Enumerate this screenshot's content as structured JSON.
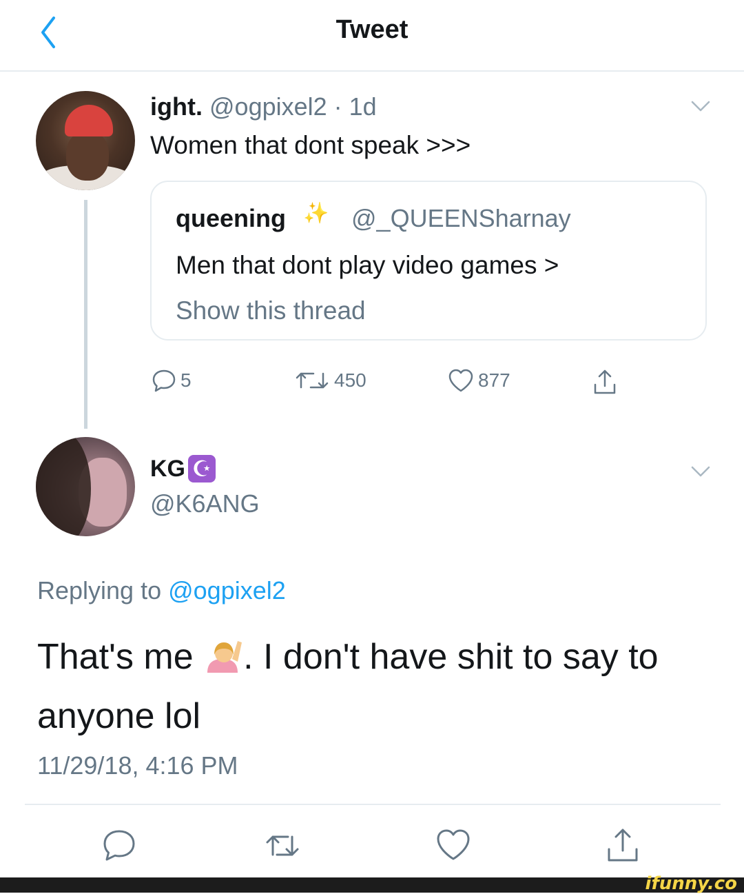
{
  "header": {
    "title": "Tweet",
    "back_icon": "chevron-left-icon"
  },
  "tweet1": {
    "name": "ight.",
    "handle": "@ogpixel2",
    "separator": " · ",
    "age": "1d",
    "text": "Women that dont speak >>>",
    "quote": {
      "name": "queening",
      "sparkle": "✨",
      "handle": "@_QUEENSharnay",
      "text": "Men that dont play video games >",
      "show_thread": "Show this thread"
    },
    "actions": {
      "replies": "5",
      "retweets": "450",
      "likes": "877"
    }
  },
  "tweet2": {
    "name": "KG",
    "badge": "☪",
    "handle": "@K6ANG",
    "replying_prefix": "Replying to ",
    "replying_handle": "@ogpixel2",
    "text_before_emoji": "That's me ",
    "text_after_emoji": ". I don't have shit to say to anyone lol",
    "timestamp": "11/29/18, 4:16 PM"
  },
  "watermark": "ifunny.co",
  "colors": {
    "accent": "#1da1f2",
    "muted": "#657786",
    "border": "#e6ecf0"
  }
}
